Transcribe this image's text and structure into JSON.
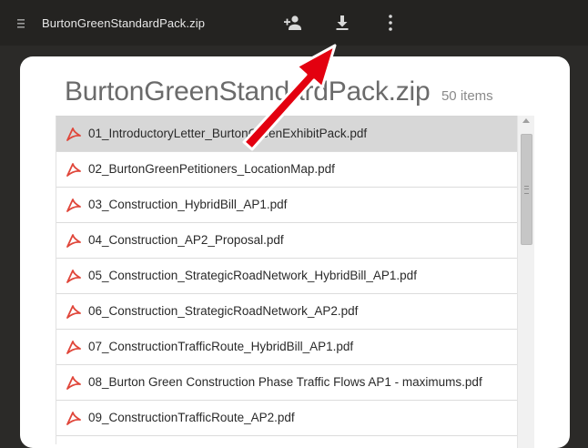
{
  "topbar": {
    "file_title": "BurtonGreenStandardPack.zip",
    "icons": [
      "menu-icon",
      "add-person-icon",
      "download-icon",
      "more-vert-icon"
    ]
  },
  "header": {
    "title": "BurtonGreenStandardPack.zip",
    "count": "50 items"
  },
  "files": [
    "01_IntroductoryLetter_BurtonGreenExhibitPack.pdf",
    "02_BurtonGreenPetitioners_LocationMap.pdf",
    "03_Construction_HybridBill_AP1.pdf",
    "04_Construction_AP2_Proposal.pdf",
    "05_Construction_StrategicRoadNetwork_HybridBill_AP1.pdf",
    "06_Construction_StrategicRoadNetwork_AP2.pdf",
    "07_ConstructionTrafficRoute_HybridBill_AP1.pdf",
    "08_Burton Green Construction Phase Traffic Flows AP1 - maximums.pdf",
    "09_ConstructionTrafficRoute_AP2.pdf"
  ],
  "colors": {
    "topbar_bg": "#242321",
    "panel_bg": "#ffffff",
    "pdf_icon": "#e0463a",
    "arrow": "#e3000f",
    "selected_row": "#d7d7d7"
  }
}
